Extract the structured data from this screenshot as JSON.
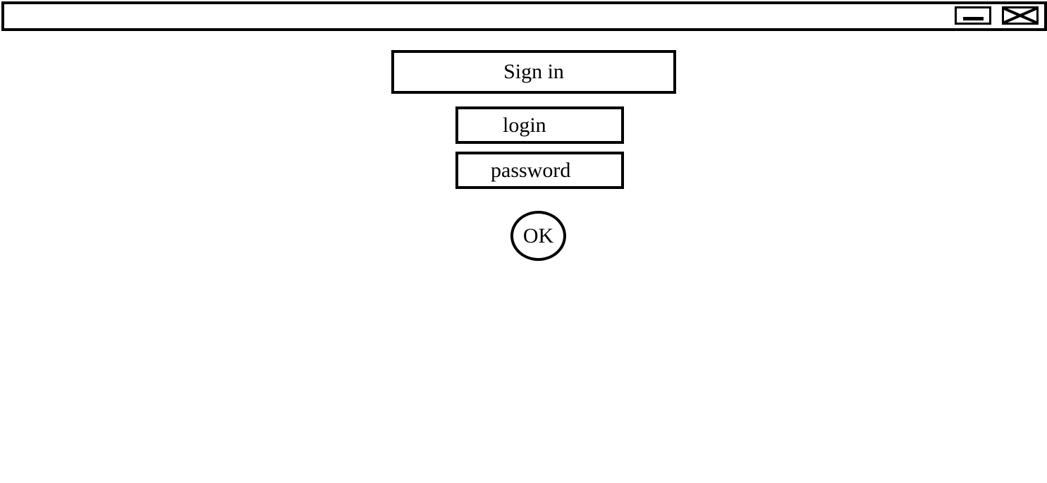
{
  "window": {
    "title": "",
    "controls": {
      "minimize_icon": "minimize-icon",
      "close_icon": "close-icon"
    }
  },
  "form": {
    "heading": "Sign in",
    "login": {
      "placeholder": "login",
      "value": ""
    },
    "password": {
      "placeholder": "password",
      "value": ""
    },
    "ok_label": "OK"
  },
  "colors": {
    "stroke": "#000000",
    "background": "#ffffff"
  }
}
